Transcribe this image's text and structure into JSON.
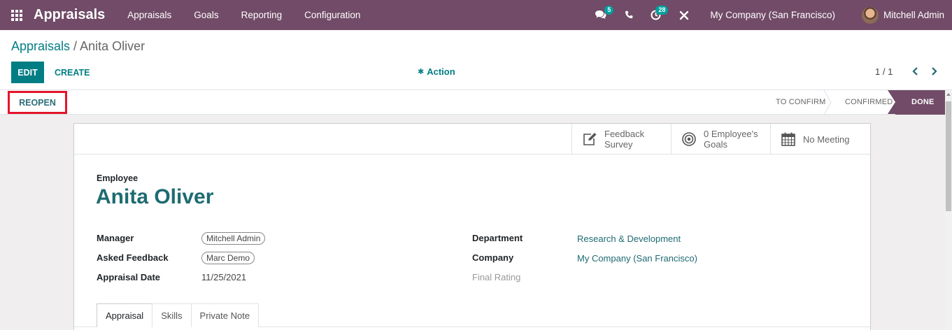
{
  "navbar": {
    "app_title": "Appraisals",
    "menu": [
      "Appraisals",
      "Goals",
      "Reporting",
      "Configuration"
    ],
    "messages_badge": "5",
    "activities_badge": "28",
    "company": "My Company (San Francisco)",
    "user": "Mitchell Admin"
  },
  "breadcrumb": {
    "parent": "Appraisals",
    "separator": " / ",
    "current": "Anita Oliver"
  },
  "toolbar": {
    "edit_label": "EDIT",
    "create_label": "CREATE",
    "action_label": "Action",
    "pager": "1 / 1"
  },
  "statusbar": {
    "reopen_label": "REOPEN",
    "stages": [
      "TO CONFIRM",
      "CONFIRMED",
      "DONE"
    ],
    "active_stage": "DONE"
  },
  "stat_buttons": {
    "feedback_line1": "Feedback",
    "feedback_line2": "Survey",
    "goals_line1": "0 Employee's",
    "goals_line2": "Goals",
    "meeting": "No Meeting"
  },
  "form": {
    "employee_label": "Employee",
    "employee_name": "Anita Oliver",
    "manager_label": "Manager",
    "manager_value": "Mitchell Admin",
    "asked_feedback_label": "Asked Feedback",
    "asked_feedback_value": "Marc Demo",
    "appraisal_date_label": "Appraisal Date",
    "appraisal_date_value": "11/25/2021",
    "department_label": "Department",
    "department_value": "Research & Development",
    "company_label": "Company",
    "company_value": "My Company (San Francisco)",
    "final_rating_label": "Final Rating"
  },
  "tabs": [
    "Appraisal",
    "Skills",
    "Private Note"
  ],
  "colors": {
    "brand": "#714b67",
    "accent": "#017e84",
    "highlight": "#e4152b"
  },
  "icons": {
    "apps": "apps-grid-icon",
    "messages": "chat-icon",
    "phone": "phone-icon",
    "activities": "clock-icon",
    "debug": "tools-icon",
    "action": "gear-icon",
    "feedback": "pencil-square-icon",
    "goals": "bullseye-icon",
    "meeting": "calendar-icon"
  }
}
